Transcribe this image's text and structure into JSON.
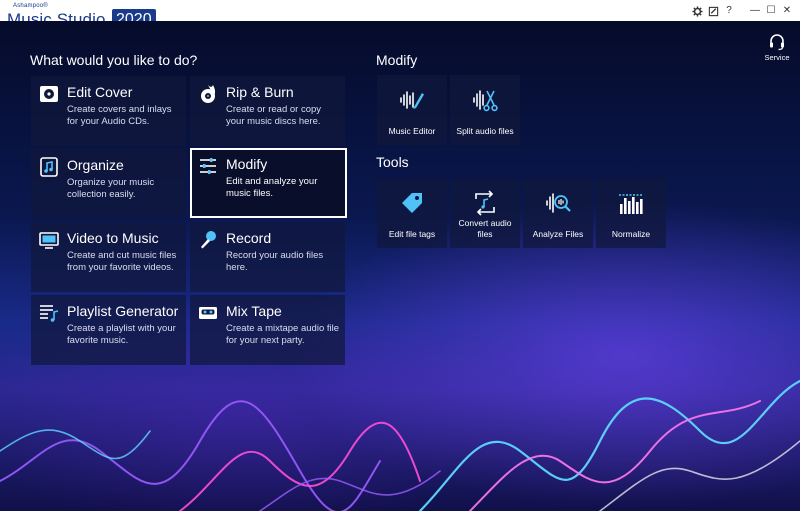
{
  "app": {
    "vendor": "Ashampoo®",
    "name": "Music Studio",
    "year": "2020"
  },
  "window_controls": {
    "settings_icon": "gear-icon",
    "feedback_icon": "note-icon",
    "help": "?",
    "minimize": "—",
    "maximize": "☐",
    "close": "✕"
  },
  "service": {
    "label": "Service",
    "icon": "headset-icon"
  },
  "main": {
    "heading": "What would you like to do?",
    "cards": [
      {
        "title": "Edit Cover",
        "desc": "Create covers and inlays for your Audio CDs.",
        "icon": "cd-cover-icon"
      },
      {
        "title": "Rip & Burn",
        "desc": "Create or read or copy your music discs here.",
        "icon": "disc-burn-icon"
      },
      {
        "title": "Organize",
        "desc": "Organize your music collection easily.",
        "icon": "music-note-icon"
      },
      {
        "title": "Modify",
        "desc": "Edit and analyze your music files.",
        "icon": "sliders-icon"
      },
      {
        "title": "Video to Music",
        "desc": "Create and cut music files from your favorite videos.",
        "icon": "monitor-icon"
      },
      {
        "title": "Record",
        "desc": "Record your audio files here.",
        "icon": "microphone-icon"
      },
      {
        "title": "Playlist Generator",
        "desc": "Create a playlist with your favorite music.",
        "icon": "playlist-icon"
      },
      {
        "title": "Mix Tape",
        "desc": "Create a mixtape audio file for your next party.",
        "icon": "cassette-icon"
      }
    ]
  },
  "modify": {
    "heading": "Modify",
    "tiles": [
      {
        "label": "Music Editor",
        "icon": "waveform-edit-icon"
      },
      {
        "label": "Split audio files",
        "icon": "waveform-scissors-icon"
      }
    ]
  },
  "tools": {
    "heading": "Tools",
    "tiles": [
      {
        "label": "Edit file tags",
        "icon": "tag-icon"
      },
      {
        "label": "Convert audio files",
        "icon": "convert-icon"
      },
      {
        "label": "Analyze Files",
        "icon": "waveform-magnify-icon"
      },
      {
        "label": "Normalize",
        "icon": "normalize-bars-icon"
      }
    ]
  },
  "colors": {
    "brand": "#1a3a8a",
    "accent_icon": "#4fc3f7",
    "card_bg": "#10183c",
    "active_border": "#ffffff"
  }
}
